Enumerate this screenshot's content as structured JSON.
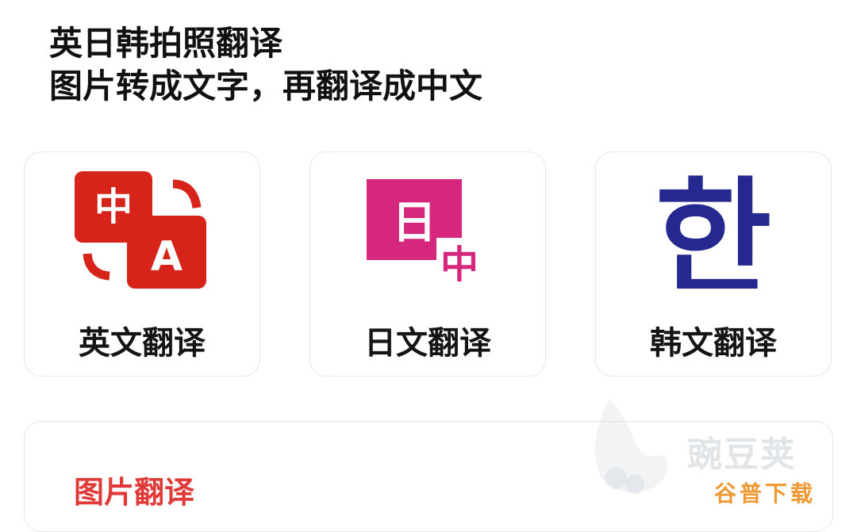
{
  "header": {
    "title": "英日韩拍照翻译",
    "subtitle": "图片转成文字，再翻译成中文"
  },
  "cards": [
    {
      "label": "英文翻译",
      "icon": "english-translate-icon",
      "icon_text_top": "中",
      "icon_text_bottom": "A",
      "color": "#d7241b"
    },
    {
      "label": "日文翻译",
      "icon": "japanese-translate-icon",
      "icon_text_top": "日",
      "icon_text_bottom": "中",
      "color": "#d6277f"
    },
    {
      "label": "韩文翻译",
      "icon": "korean-translate-icon",
      "icon_text": "한",
      "color": "#24288f"
    }
  ],
  "photo_translate": {
    "title": "图片翻译",
    "color": "#e03a38"
  },
  "watermark": {
    "brand": "豌豆荚",
    "sub": "谷普下载"
  }
}
